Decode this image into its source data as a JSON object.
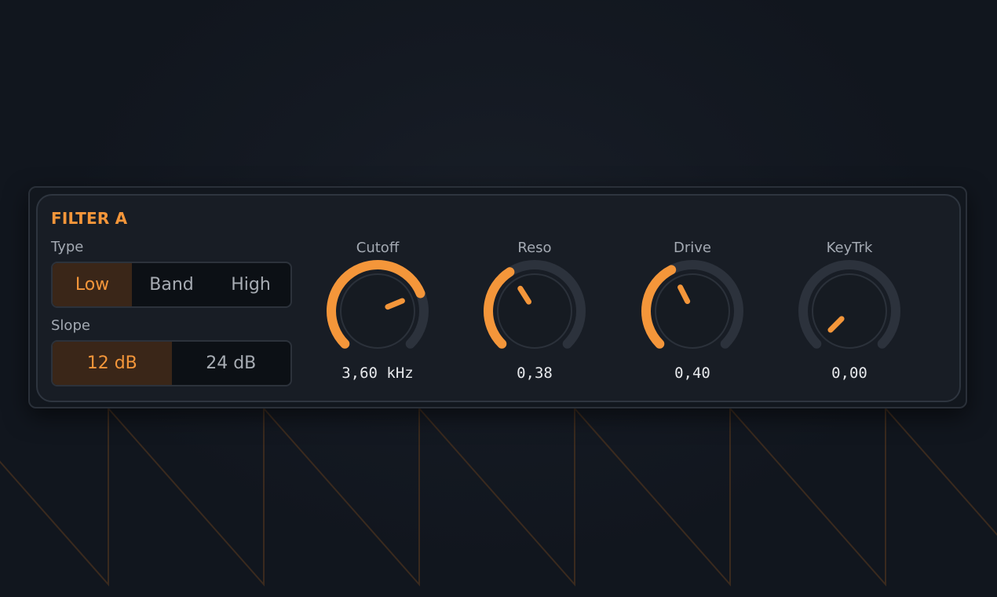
{
  "module": {
    "title": "FILTER A",
    "accent_color": "#f4963a"
  },
  "type": {
    "label": "Type",
    "options": [
      "Low",
      "Band",
      "High"
    ],
    "selected": "Low"
  },
  "slope": {
    "label": "Slope",
    "options": [
      "12 dB",
      "24 dB"
    ],
    "selected": "12 dB"
  },
  "knobs": [
    {
      "label": "Cutoff",
      "value_text": "3,60 kHz",
      "level": 0.75
    },
    {
      "label": "Reso",
      "value_text": "0,38",
      "level": 0.38
    },
    {
      "label": "Drive",
      "value_text": "0,40",
      "level": 0.4
    },
    {
      "label": "KeyTrk",
      "value_text": "0,00",
      "level": 0.0
    }
  ]
}
